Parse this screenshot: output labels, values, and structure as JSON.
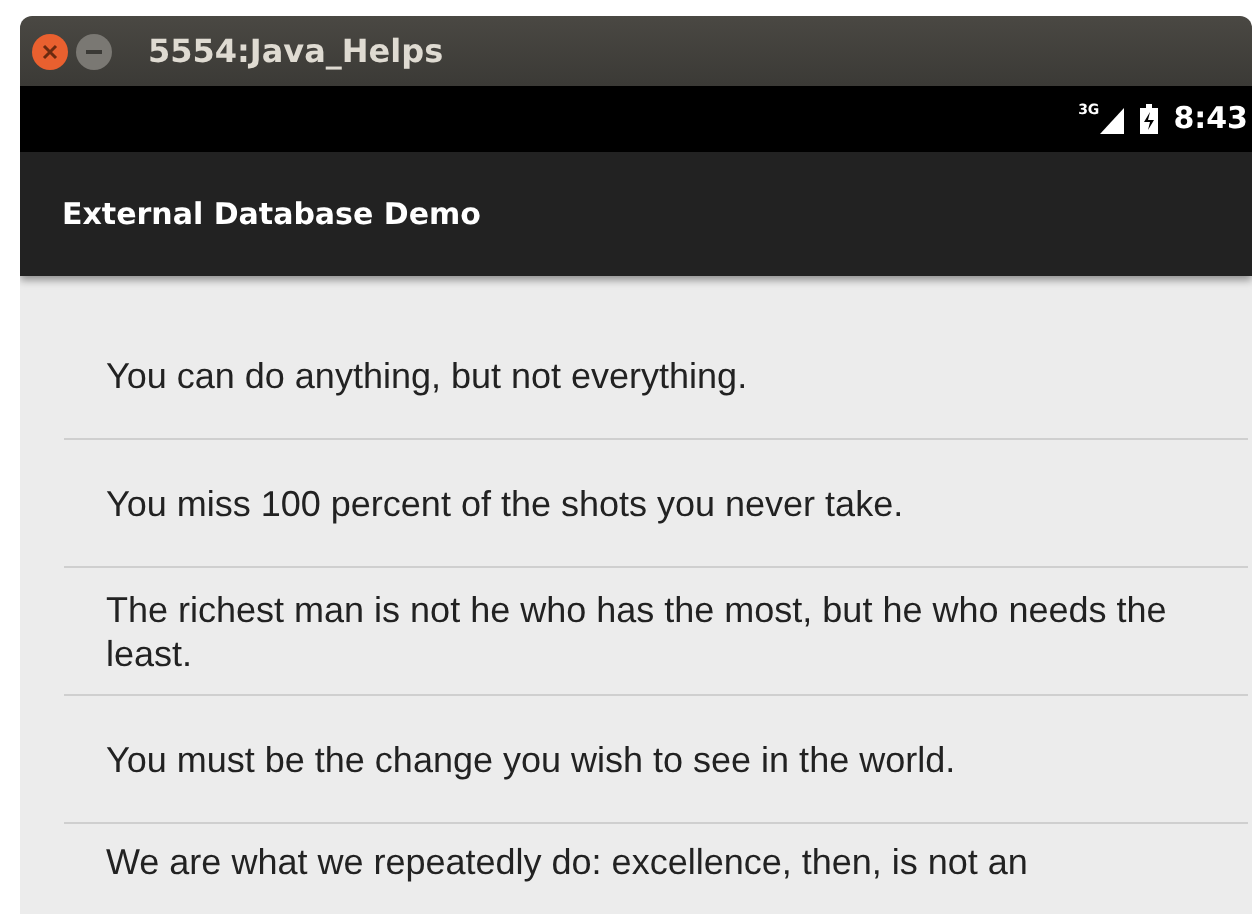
{
  "window": {
    "title": "5554:Java_Helps"
  },
  "status_bar": {
    "network": "3G",
    "time": "8:43"
  },
  "action_bar": {
    "title": "External Database Demo"
  },
  "quotes": [
    "You can do anything, but not everything.",
    "You miss 100 percent of the shots you never take.",
    "The richest man is not he who has the most, but he who needs the least.",
    "You must be the change you wish to see in the world.",
    "We are what we repeatedly do: excellence, then, is not an"
  ]
}
